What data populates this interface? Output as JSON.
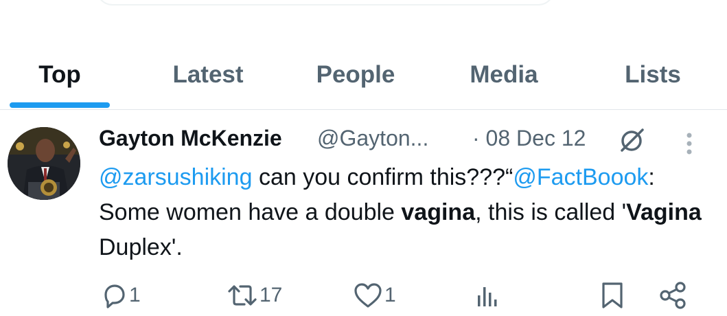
{
  "tabs": [
    {
      "label": "Top",
      "active": true
    },
    {
      "label": "Latest",
      "active": false
    },
    {
      "label": "People",
      "active": false
    },
    {
      "label": "Media",
      "active": false
    },
    {
      "label": "Lists",
      "active": false
    }
  ],
  "tweet": {
    "author_name": "Gayton McKenzie",
    "author_handle": "@Gayton...",
    "date": "· 08 Dec 12",
    "text": {
      "mention1": "@zarsushiking",
      "part1": " can you confirm this???“",
      "mention2": "@FactBoook",
      "part2": ": Some women have a double ",
      "bold1": "vagina",
      "part3": ", this is called '",
      "bold2": "Vagina",
      "part4": " Duplex'."
    },
    "counts": {
      "replies": "1",
      "retweets": "17",
      "likes": "1"
    }
  },
  "icons": {
    "reply": "reply-icon",
    "retweet": "retweet-icon",
    "like": "like-icon",
    "views": "views-icon",
    "bookmark": "bookmark-icon",
    "share": "share-icon",
    "grok": "grok-icon",
    "more": "more-icon"
  },
  "colors": {
    "accent": "#1d9bf0",
    "muted": "#536471",
    "text": "#0f1419"
  }
}
